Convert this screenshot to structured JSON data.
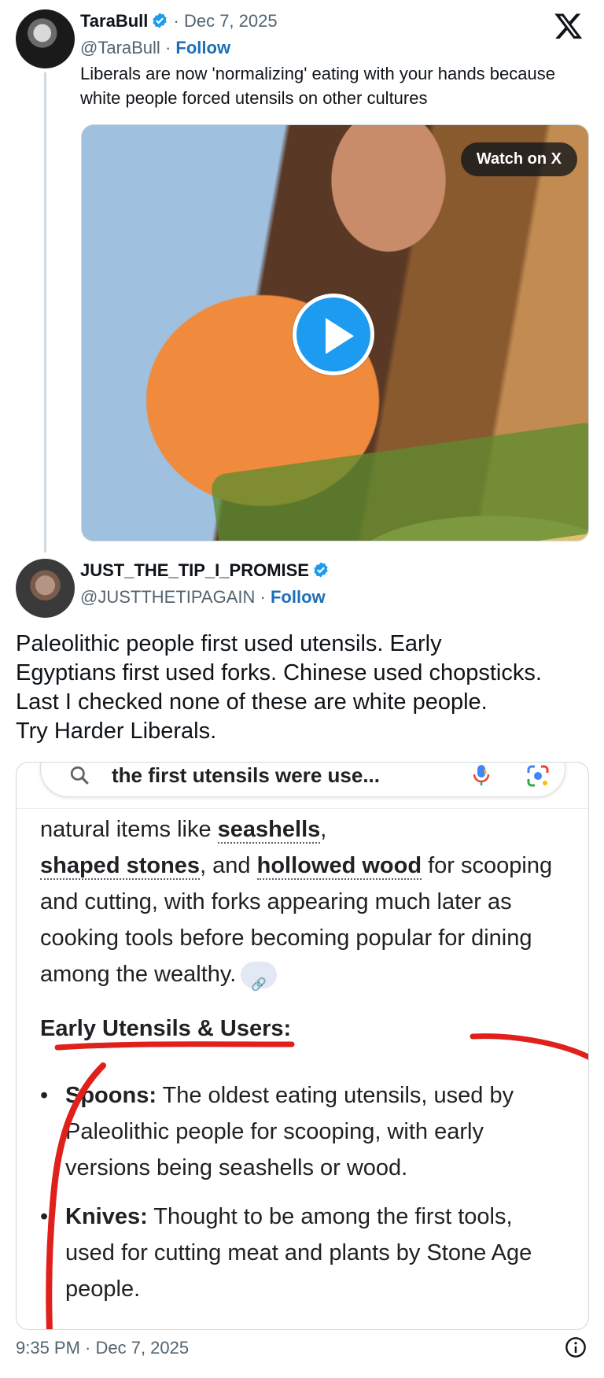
{
  "post1": {
    "author_name": "TaraBull",
    "date_sep": "· Dec 7, 2025",
    "handle": "@TaraBull",
    "sep": "·",
    "follow": "Follow",
    "text": "Liberals are now 'normalizing' eating with your hands because white people forced utensils on other cultures",
    "video": {
      "watch_label": "Watch on X"
    }
  },
  "post2": {
    "author_name": "JUST_THE_TIP_I_PROMISE",
    "handle": "@JUSTTHETIPAGAIN",
    "sep": "·",
    "follow": "Follow",
    "text_lines": [
      "Paleolithic people first used utensils. Early",
      "Egyptians first used forks. Chinese used chopsticks.",
      "Last I checked none of these are white people.",
      "Try Harder Liberals."
    ],
    "screenshot": {
      "search_query": "the first utensils were use...",
      "para_part1": "natural items like ",
      "link1": "seashells",
      "para_part2": ",",
      "link2": "shaped stones",
      "para_part3": ", and ",
      "link3": "hollowed wood",
      "para_part4": " for scooping and cutting, with forks appearing much later as cooking tools before becoming popular for dining among the wealthy.",
      "heading": "Early Utensils & Users:",
      "bullets": [
        {
          "term": "Spoons:",
          "text": " The oldest eating utensils, used by Paleolithic people for scooping, with early versions being seashells or wood."
        },
        {
          "term": "Knives:",
          "text": " Thought to be among the first tools, used for cutting meat and plants by Stone Age people."
        }
      ]
    }
  },
  "footer": {
    "timestamp": "9:35 PM · Dec 7, 2025"
  },
  "icons": {
    "verified": "verified-badge-icon",
    "x_logo": "x-logo-icon",
    "play": "play-icon",
    "search": "search-icon",
    "mic": "mic-icon",
    "lens": "lens-icon",
    "link": "link-icon",
    "info": "info-icon"
  },
  "colors": {
    "follow": "#1d6fb8",
    "verified": "#1d9bf0",
    "play_button": "#1d9bf0",
    "annotation_red": "#e0201b"
  }
}
